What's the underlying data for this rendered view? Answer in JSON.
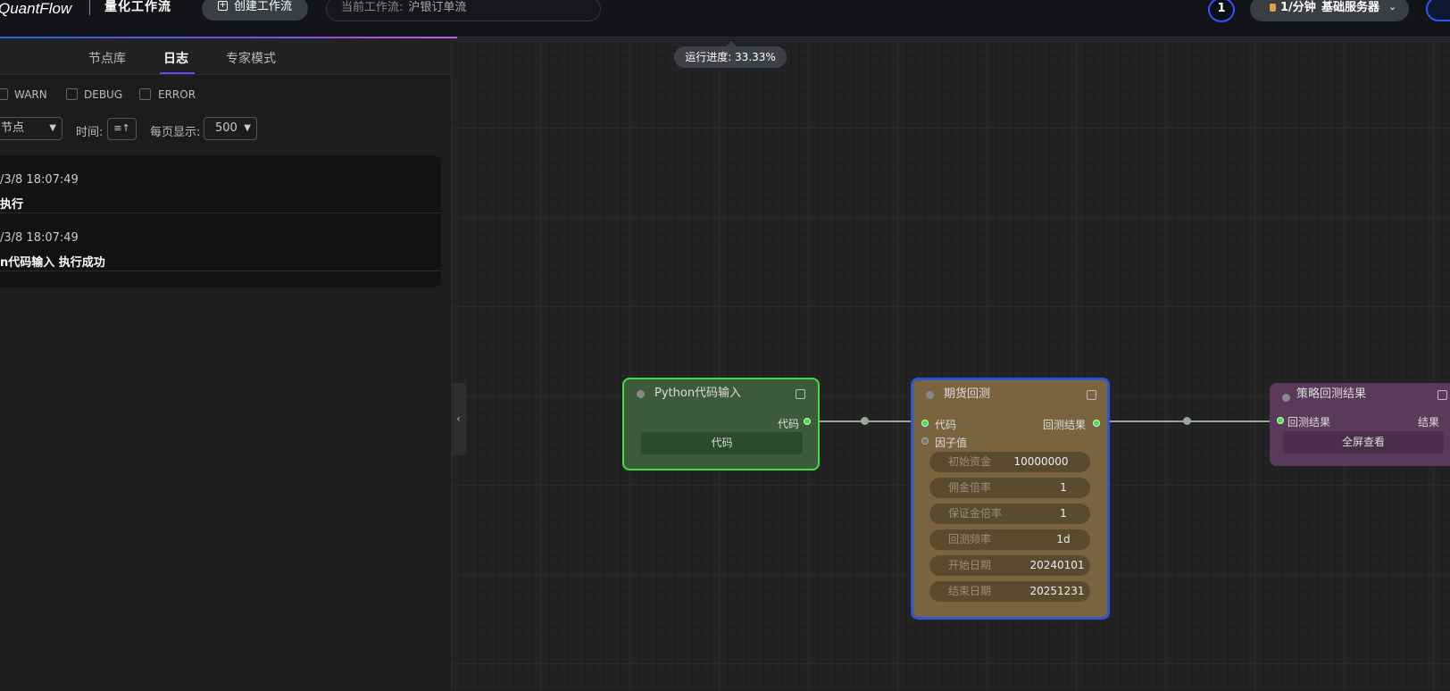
{
  "app": {
    "brand": "QuantFlow",
    "subtitle": "量化工作流"
  },
  "header": {
    "create_label": "创建工作流",
    "current_prefix": "当前工作流:",
    "current_value": "沪银订单流",
    "user_count": "1",
    "rate_label": "1/分钟",
    "server_label": "基础服务器"
  },
  "panel": {
    "tabs": [
      {
        "label": "节点库"
      },
      {
        "label": "日志"
      },
      {
        "label": "专家模式"
      }
    ],
    "filters": [
      {
        "label": "WARN"
      },
      {
        "label": "DEBUG"
      },
      {
        "label": "ERROR"
      }
    ],
    "node_select": "节点",
    "time_label": "时间:",
    "page_size_label": "每页显示:",
    "page_size_value": "500",
    "logs": [
      {
        "time": "/3/8 18:07:49",
        "message": "执行"
      },
      {
        "time": "/3/8 18:07:49",
        "message": "n代码输入 执行成功"
      }
    ]
  },
  "canvas": {
    "run_progress": "运行进度: 33.33%",
    "nodes": {
      "python": {
        "title": "Python代码输入",
        "output": "代码",
        "button": "代码",
        "color": "#3b5b3b"
      },
      "backtest": {
        "title": "期货回测",
        "input_code": "代码",
        "input_factor": "因子值",
        "output": "回测结果",
        "params": [
          {
            "key": "初始资金",
            "value": "10000000"
          },
          {
            "key": "佣金倍率",
            "value": "1"
          },
          {
            "key": "保证金倍率",
            "value": "1"
          },
          {
            "key": "回测频率",
            "value": "1d"
          },
          {
            "key": "开始日期",
            "value": "20240101"
          },
          {
            "key": "结束日期",
            "value": "20251231"
          }
        ],
        "color": "#7a6440"
      },
      "result": {
        "title": "策略回测结果",
        "input": "回测结果",
        "output": "结果",
        "button": "全屏查看",
        "color": "#5a3a5a"
      }
    }
  }
}
